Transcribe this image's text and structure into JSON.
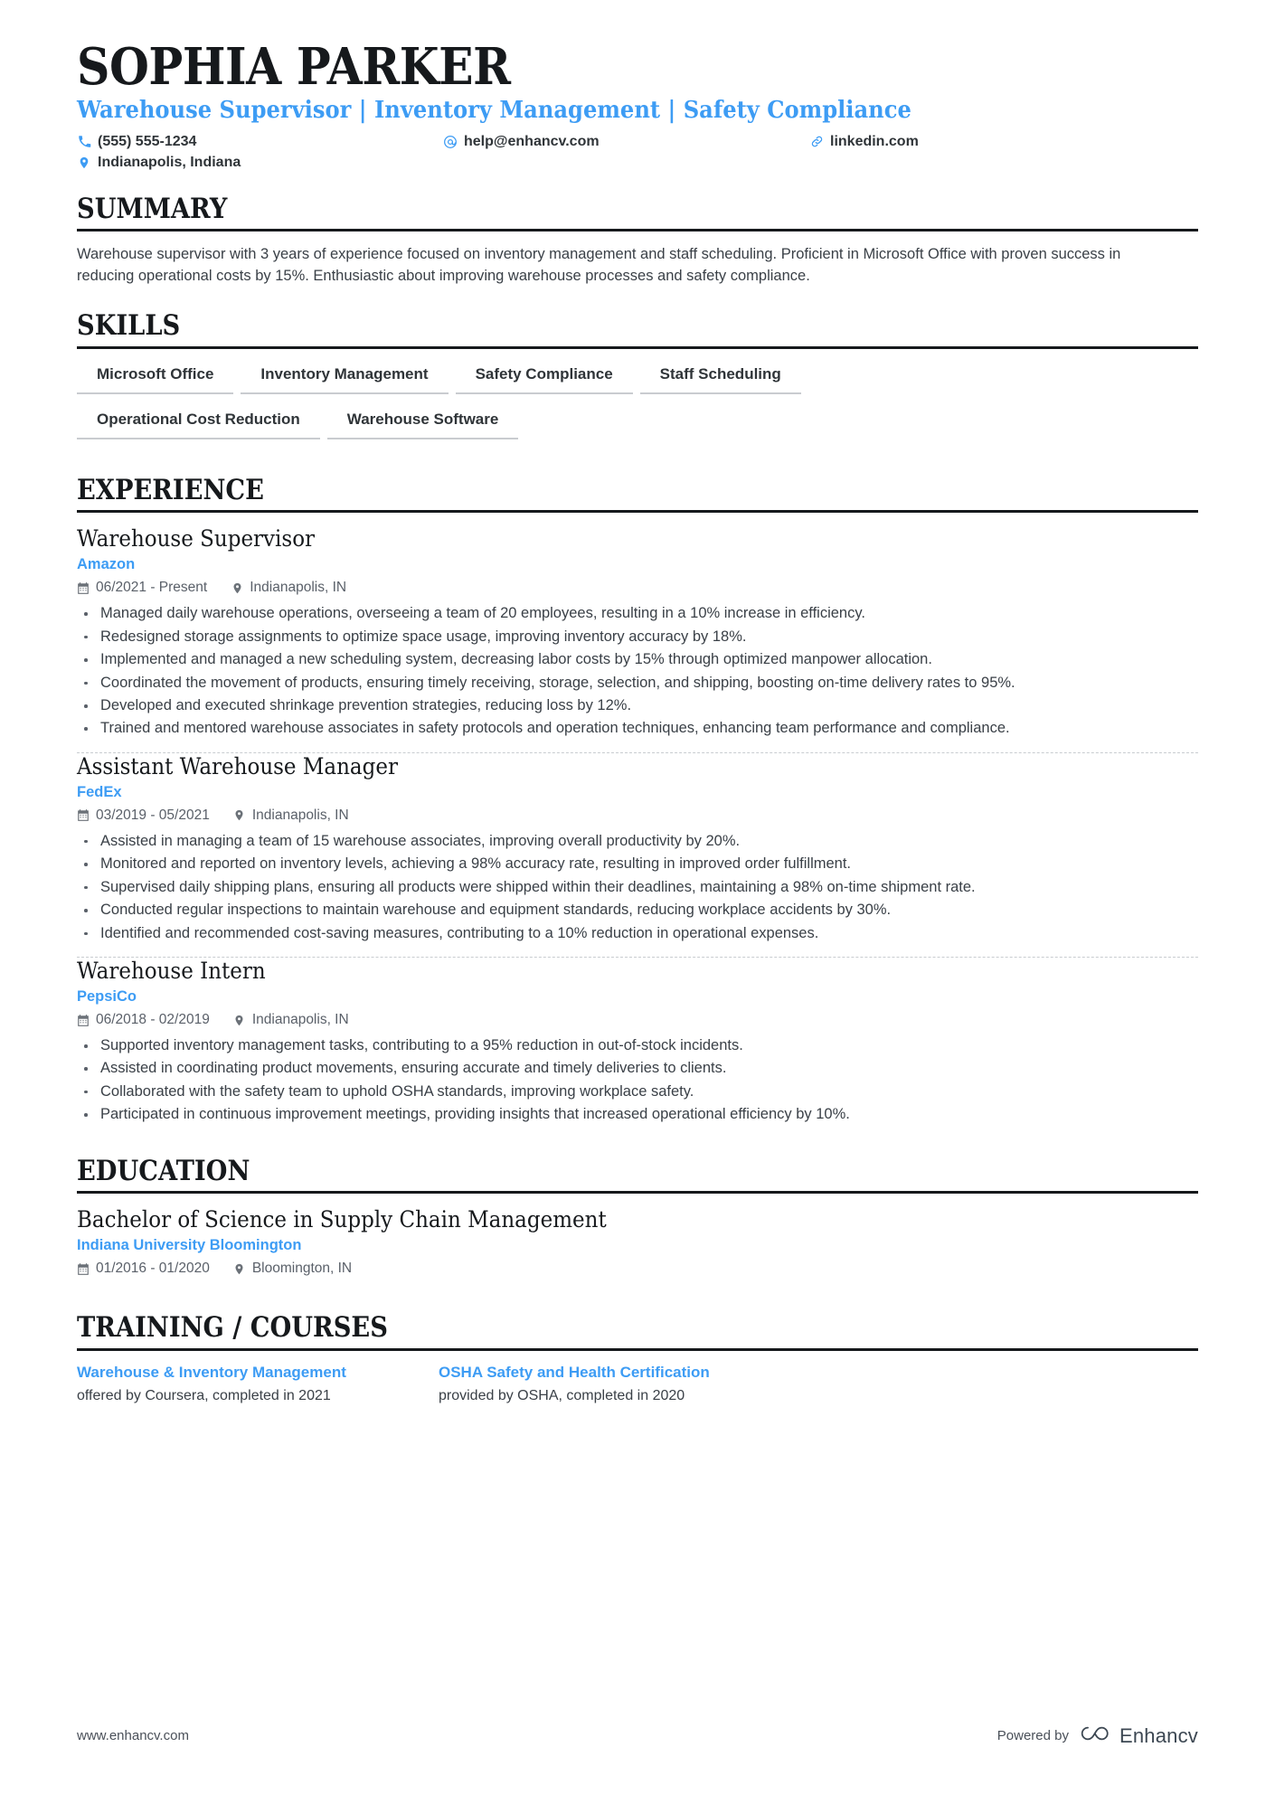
{
  "colors": {
    "accent": "#3d9cf4",
    "ink": "#16191c",
    "body": "#3a4047",
    "muted": "#5a6069",
    "rule": "#16191c",
    "chip_rule": "#c9ccd0"
  },
  "header": {
    "name": "SOPHIA PARKER",
    "headline": "Warehouse Supervisor | Inventory Management | Safety Compliance",
    "contacts": [
      {
        "icon": "phone-icon",
        "text": "(555) 555-1234"
      },
      {
        "icon": "email-icon",
        "text": "help@enhancv.com"
      },
      {
        "icon": "link-icon",
        "text": "linkedin.com"
      },
      {
        "icon": "location-pin-icon",
        "text": "Indianapolis, Indiana"
      }
    ]
  },
  "sections": {
    "summary": {
      "heading": "SUMMARY",
      "text": "Warehouse supervisor with 3 years of experience focused on inventory management and staff scheduling. Proficient in Microsoft Office with proven success in reducing operational costs by 15%. Enthusiastic about improving warehouse processes and safety compliance."
    },
    "skills": {
      "heading": "SKILLS",
      "items": [
        "Microsoft Office",
        "Inventory Management",
        "Safety Compliance",
        "Staff Scheduling",
        "Operational Cost Reduction",
        "Warehouse Software"
      ]
    },
    "experience": {
      "heading": "EXPERIENCE",
      "entries": [
        {
          "role": "Warehouse Supervisor",
          "org": "Amazon",
          "date": "06/2021 - Present",
          "location": "Indianapolis, IN",
          "bullets": [
            "Managed daily warehouse operations, overseeing a team of 20 employees, resulting in a 10% increase in efficiency.",
            "Redesigned storage assignments to optimize space usage, improving inventory accuracy by 18%.",
            "Implemented and managed a new scheduling system, decreasing labor costs by 15% through optimized manpower allocation.",
            "Coordinated the movement of products, ensuring timely receiving, storage, selection, and shipping, boosting on-time delivery rates to 95%.",
            "Developed and executed shrinkage prevention strategies, reducing loss by 12%.",
            "Trained and mentored warehouse associates in safety protocols and operation techniques, enhancing team performance and compliance."
          ]
        },
        {
          "role": "Assistant Warehouse Manager",
          "org": "FedEx",
          "date": "03/2019 - 05/2021",
          "location": "Indianapolis, IN",
          "bullets": [
            "Assisted in managing a team of 15 warehouse associates, improving overall productivity by 20%.",
            "Monitored and reported on inventory levels, achieving a 98% accuracy rate, resulting in improved order fulfillment.",
            "Supervised daily shipping plans, ensuring all products were shipped within their deadlines, maintaining a 98% on-time shipment rate.",
            "Conducted regular inspections to maintain warehouse and equipment standards, reducing workplace accidents by 30%.",
            "Identified and recommended cost-saving measures, contributing to a 10% reduction in operational expenses."
          ]
        },
        {
          "role": "Warehouse Intern",
          "org": "PepsiCo",
          "date": "06/2018 - 02/2019",
          "location": "Indianapolis, IN",
          "bullets": [
            "Supported inventory management tasks, contributing to a 95% reduction in out-of-stock incidents.",
            "Assisted in coordinating product movements, ensuring accurate and timely deliveries to clients.",
            "Collaborated with the safety team to uphold OSHA standards, improving workplace safety.",
            "Participated in continuous improvement meetings, providing insights that increased operational efficiency by 10%."
          ]
        }
      ]
    },
    "education": {
      "heading": "EDUCATION",
      "entries": [
        {
          "degree": "Bachelor of Science in Supply Chain Management",
          "school": "Indiana University Bloomington",
          "date": "01/2016 - 01/2020",
          "location": "Bloomington, IN"
        }
      ]
    },
    "training": {
      "heading": "TRAINING / COURSES",
      "courses": [
        {
          "title": "Warehouse & Inventory Management",
          "subtitle": "offered by Coursera, completed in 2021"
        },
        {
          "title": "OSHA Safety and Health Certification",
          "subtitle": "provided by OSHA, completed in 2020"
        }
      ]
    }
  },
  "footer": {
    "url": "www.enhancv.com",
    "powered_by": "Powered by",
    "brand": "Enhancv"
  }
}
